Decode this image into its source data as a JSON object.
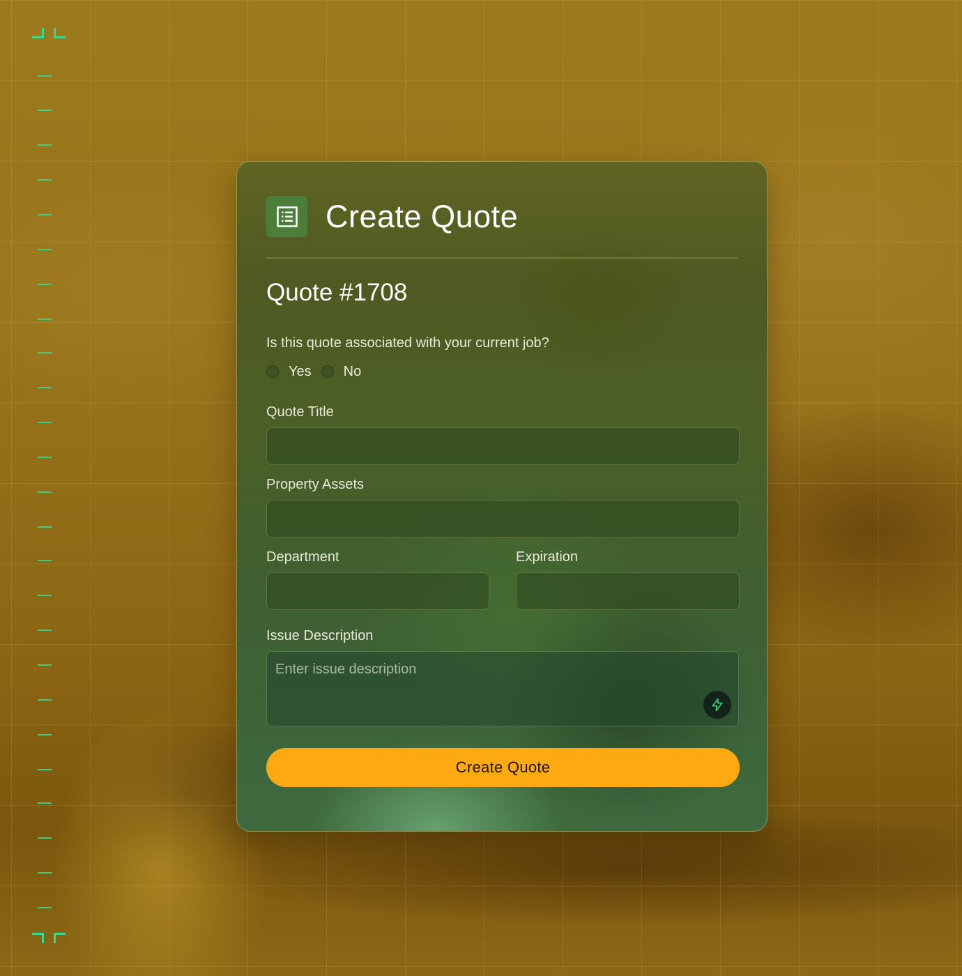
{
  "form": {
    "title": "Create Quote",
    "quote_number": "Quote #1708",
    "question": "Is this quote associated with your current job?",
    "options": [
      "Yes",
      "No"
    ],
    "fields": {
      "quote_title": {
        "label": "Quote Title",
        "value": ""
      },
      "property_assets": {
        "label": "Property Assets",
        "value": ""
      },
      "department": {
        "label": "Department",
        "value": ""
      },
      "expiration": {
        "label": "Expiration",
        "value": ""
      },
      "issue_description": {
        "label": "Issue Description",
        "placeholder": "Enter issue description",
        "value": ""
      }
    },
    "submit_label": "Create Quote"
  },
  "icons": {
    "header": "document-list-icon",
    "assist": "lightning-bolt-icon",
    "ruler_corners": "corner-bracket-icon"
  },
  "colors": {
    "accent": "#fdaa12",
    "ruler": "#37d98a",
    "header_icon_bg": "#4c7e3a",
    "bolt": "#2fd07c"
  }
}
